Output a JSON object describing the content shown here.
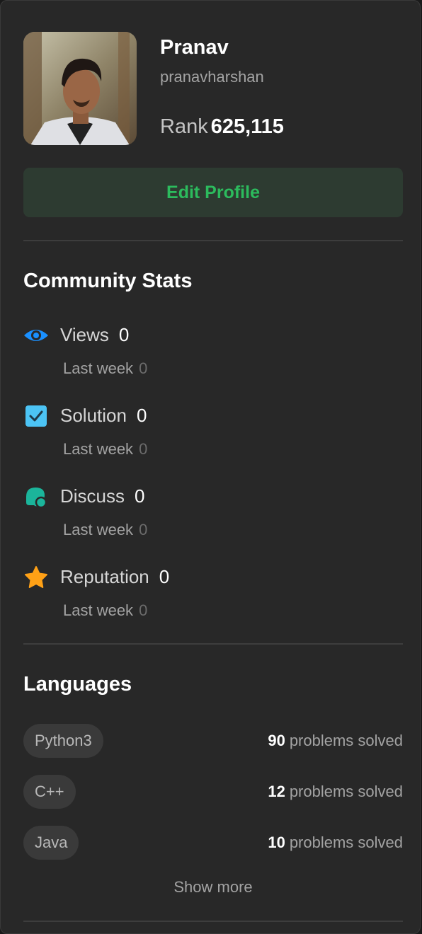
{
  "profile": {
    "name": "Pranav",
    "username": "pranavharshan",
    "rank_label": "Rank",
    "rank_value": "625,115",
    "edit_label": "Edit Profile"
  },
  "community": {
    "title": "Community Stats",
    "stats": [
      {
        "label": "Views",
        "value": "0",
        "last_week_label": "Last week",
        "last_week_value": "0",
        "icon": "eye-icon",
        "color": "#1a90ff"
      },
      {
        "label": "Solution",
        "value": "0",
        "last_week_label": "Last week",
        "last_week_value": "0",
        "icon": "checkbox-icon",
        "color": "#4cc4f5"
      },
      {
        "label": "Discuss",
        "value": "0",
        "last_week_label": "Last week",
        "last_week_value": "0",
        "icon": "discuss-bubble-icon",
        "color": "#1bb59b"
      },
      {
        "label": "Reputation",
        "value": "0",
        "last_week_label": "Last week",
        "last_week_value": "0",
        "icon": "star-icon",
        "color": "#ffa116"
      }
    ]
  },
  "languages": {
    "title": "Languages",
    "items": [
      {
        "name": "Python3",
        "count": "90",
        "suffix": "problems solved"
      },
      {
        "name": "C++",
        "count": "12",
        "suffix": "problems solved"
      },
      {
        "name": "Java",
        "count": "10",
        "suffix": "problems solved"
      }
    ],
    "show_more": "Show more"
  },
  "colors": {
    "background": "#282828",
    "accent_green": "#2cbb5d",
    "text_primary": "#ffffff",
    "text_secondary": "#a3a3a3"
  }
}
